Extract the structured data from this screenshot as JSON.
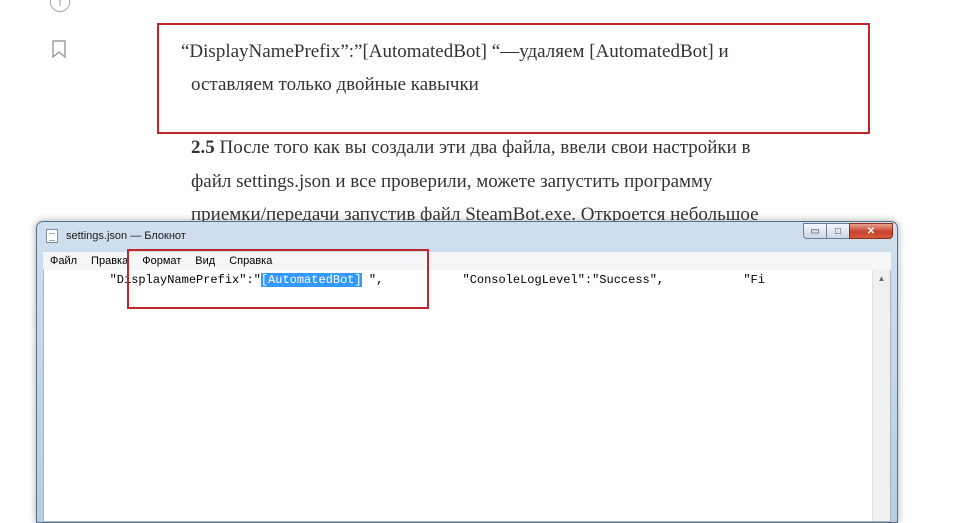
{
  "article": {
    "quote_line1": "“DisplayNamePrefix”:”[AutomatedBot] “—удаляем [AutomatedBot] и",
    "quote_line2": "оставляем только двойные кавычки",
    "step_number": "2.5",
    "step_line1_rest": " После того как вы создали эти два файла, ввели свои настройки в",
    "step_line2": "файл settings.json и все проверили, можете запустить программу",
    "step_line3": "приемки/передачи запустив файл SteamBot.exe. Откроется небольшое"
  },
  "sidebar": {
    "icons": [
      "facebook-icon",
      "bookmark-icon"
    ]
  },
  "notepad": {
    "title": "settings.json — Блокнот",
    "menu": [
      "Файл",
      "Правка",
      "Формат",
      "Вид",
      "Справка"
    ],
    "line_before_sel": "        \"DisplayNamePrefix\":\"",
    "selected": "[AutomatedBot]",
    "line_after_sel": " \",           \"ConsoleLogLevel\":\"Success\",           \"Fi",
    "buttons": {
      "minimize": "▭",
      "maximize": "□",
      "close": "✕"
    }
  },
  "colors": {
    "highlight_border": "#c0272d",
    "selection": "#3399ff",
    "close_button": "#c7422c"
  }
}
